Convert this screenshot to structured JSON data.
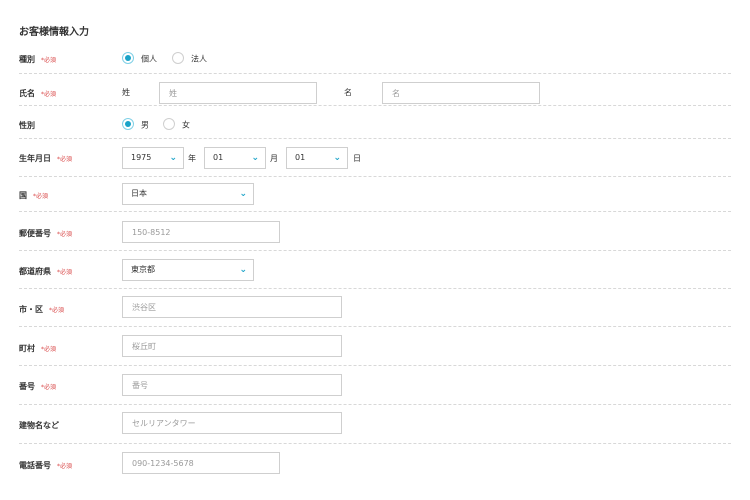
{
  "title": "お客様情報入力",
  "required": "*必須",
  "accent_color": "#1aa3c8",
  "type": {
    "label": "種別",
    "options": [
      "個人",
      "法人"
    ],
    "selected": "個人"
  },
  "name": {
    "label": "氏名",
    "last_label": "姓",
    "last_placeholder": "姓",
    "first_label": "名",
    "first_placeholder": "名"
  },
  "gender": {
    "label": "性別",
    "options": [
      "男",
      "女"
    ],
    "selected": "男"
  },
  "birthdate": {
    "label": "生年月日",
    "year": "1975",
    "year_unit": "年",
    "month": "01",
    "month_unit": "月",
    "day": "01",
    "day_unit": "日"
  },
  "country": {
    "label": "国",
    "value": "日本"
  },
  "postal": {
    "label": "郵便番号",
    "placeholder": "150-8512"
  },
  "prefecture": {
    "label": "都道府県",
    "value": "東京都"
  },
  "city": {
    "label": "市・区",
    "placeholder": "渋谷区"
  },
  "town": {
    "label": "町村",
    "placeholder": "桜丘町"
  },
  "number": {
    "label": "番号",
    "placeholder": "番号"
  },
  "building": {
    "label": "建物名など",
    "placeholder": "セルリアンタワー"
  },
  "phone": {
    "label": "電話番号",
    "placeholder": "090-1234-5678"
  }
}
